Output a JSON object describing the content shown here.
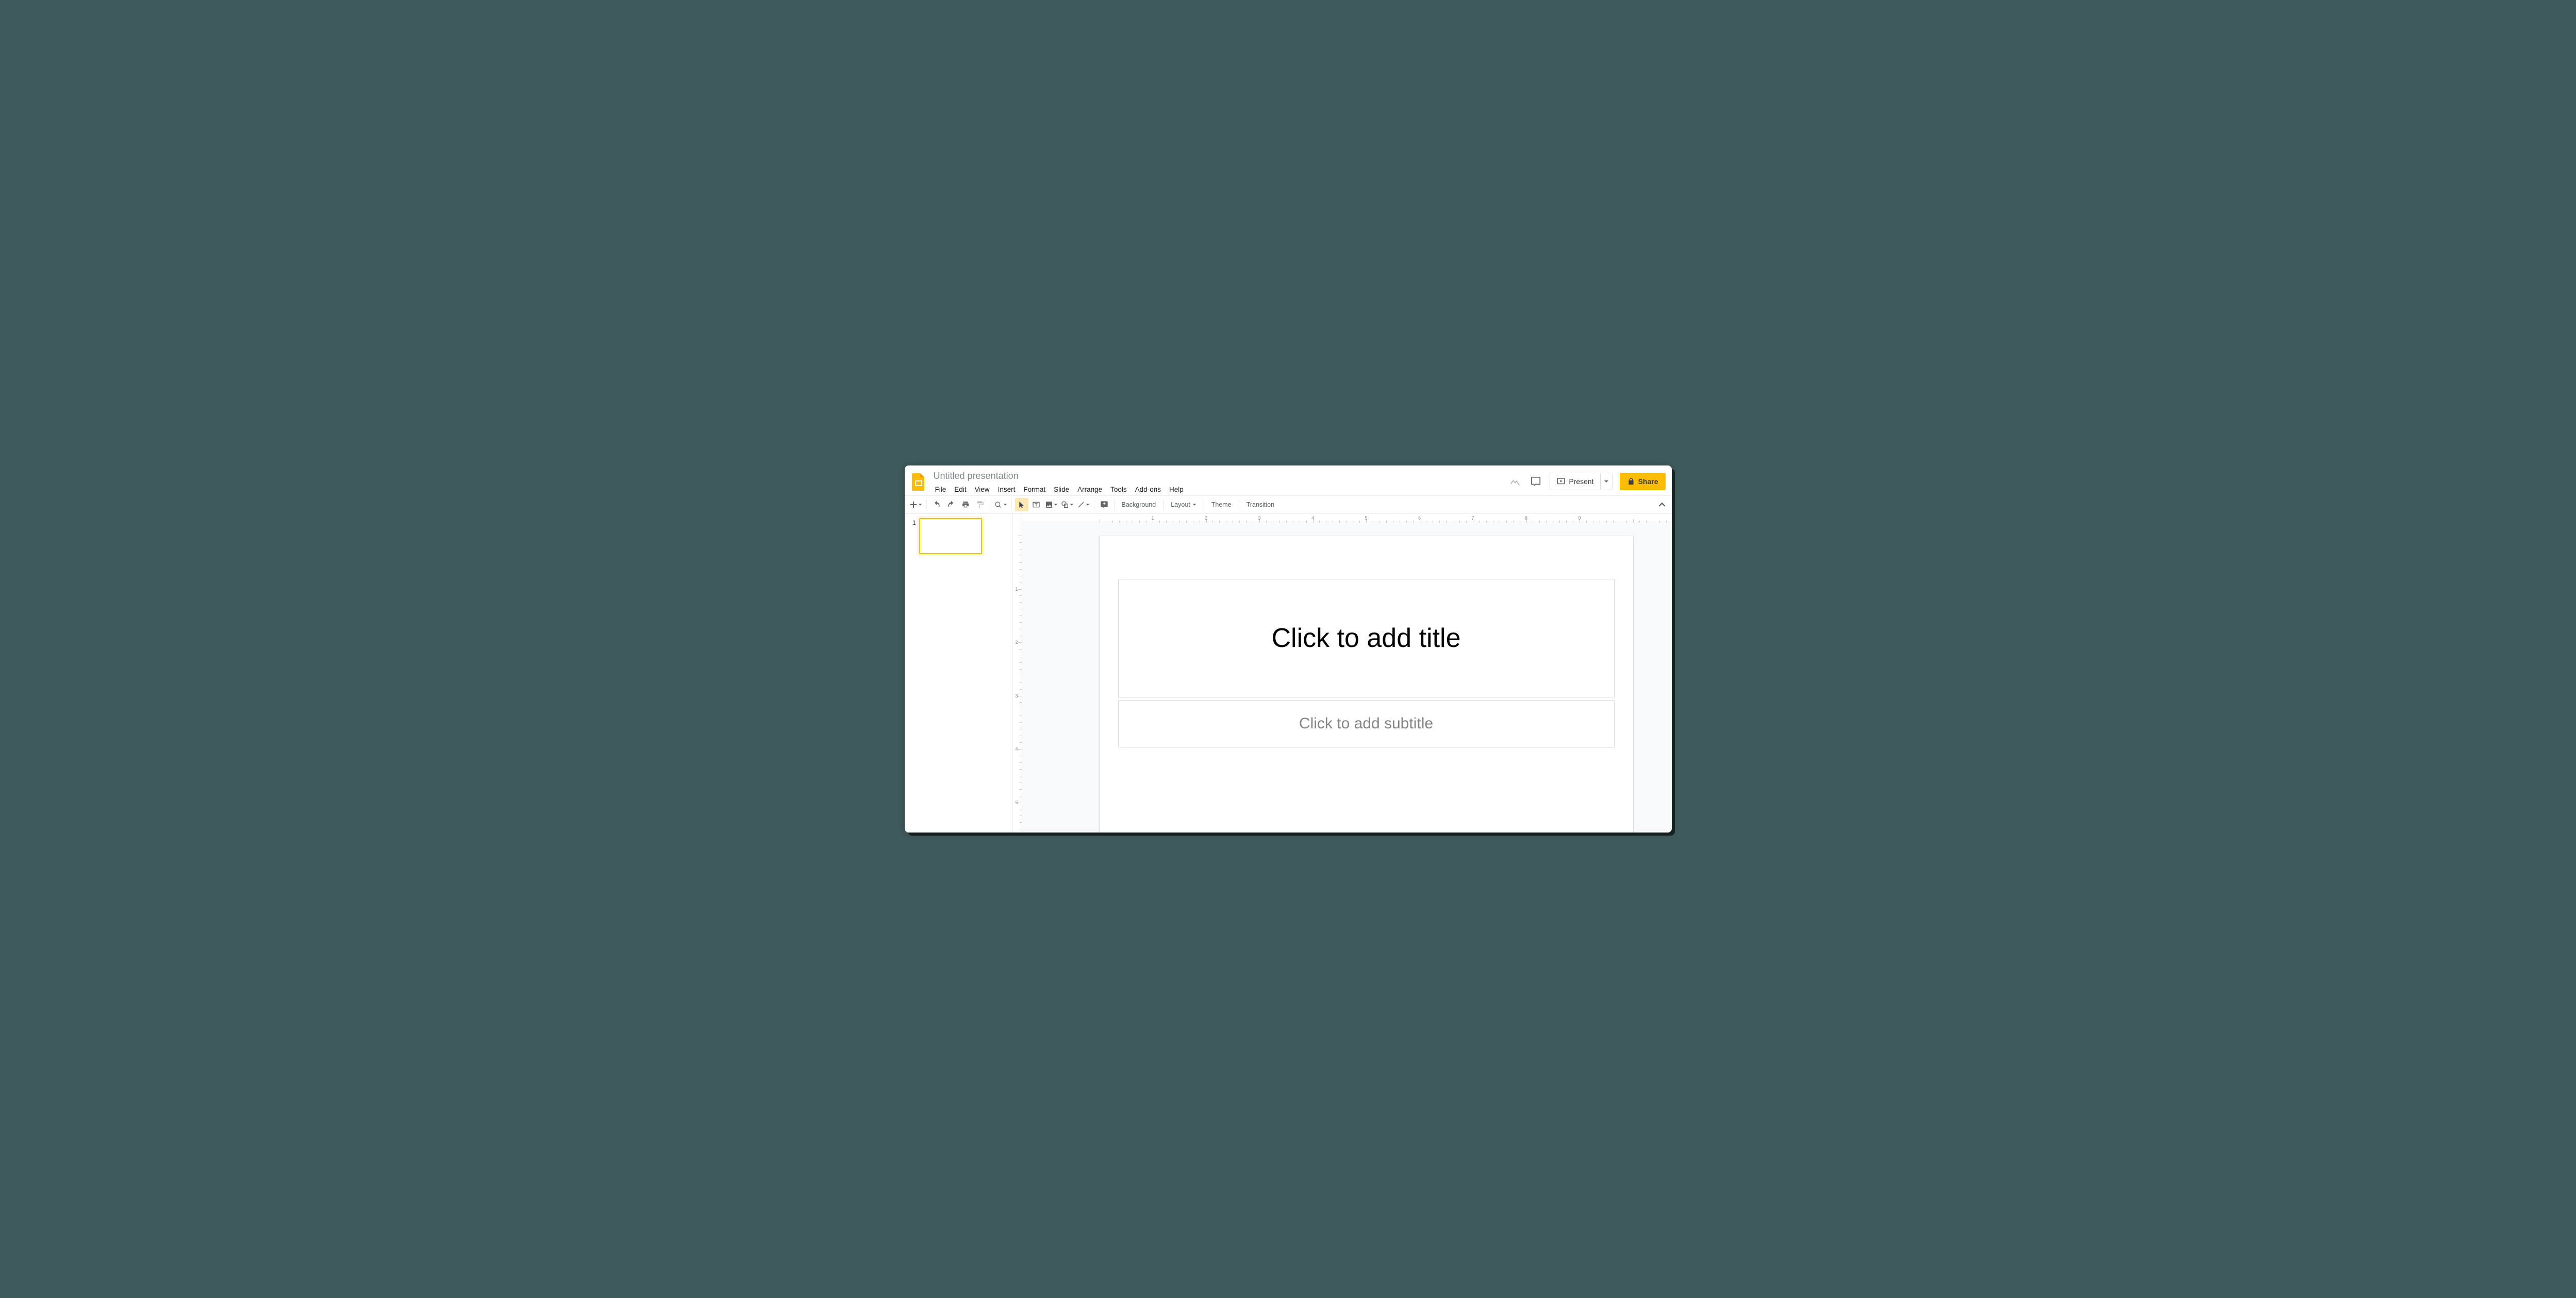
{
  "header": {
    "doc_title": "Untitled presentation",
    "menus": [
      "File",
      "Edit",
      "View",
      "Insert",
      "Format",
      "Slide",
      "Arrange",
      "Tools",
      "Add-ons",
      "Help"
    ],
    "present_label": "Present",
    "share_label": "Share"
  },
  "toolbar": {
    "background_label": "Background",
    "layout_label": "Layout",
    "theme_label": "Theme",
    "transition_label": "Transition"
  },
  "thumbs": {
    "items": [
      {
        "num": "1"
      }
    ]
  },
  "slide": {
    "title_placeholder": "Click to add title",
    "subtitle_placeholder": "Click to add subtitle"
  },
  "ruler": {
    "h_labels": [
      "1",
      "2",
      "3",
      "4",
      "5",
      "6",
      "7",
      "8",
      "9"
    ],
    "v_labels": [
      "1",
      "2",
      "3",
      "4",
      "5"
    ]
  }
}
